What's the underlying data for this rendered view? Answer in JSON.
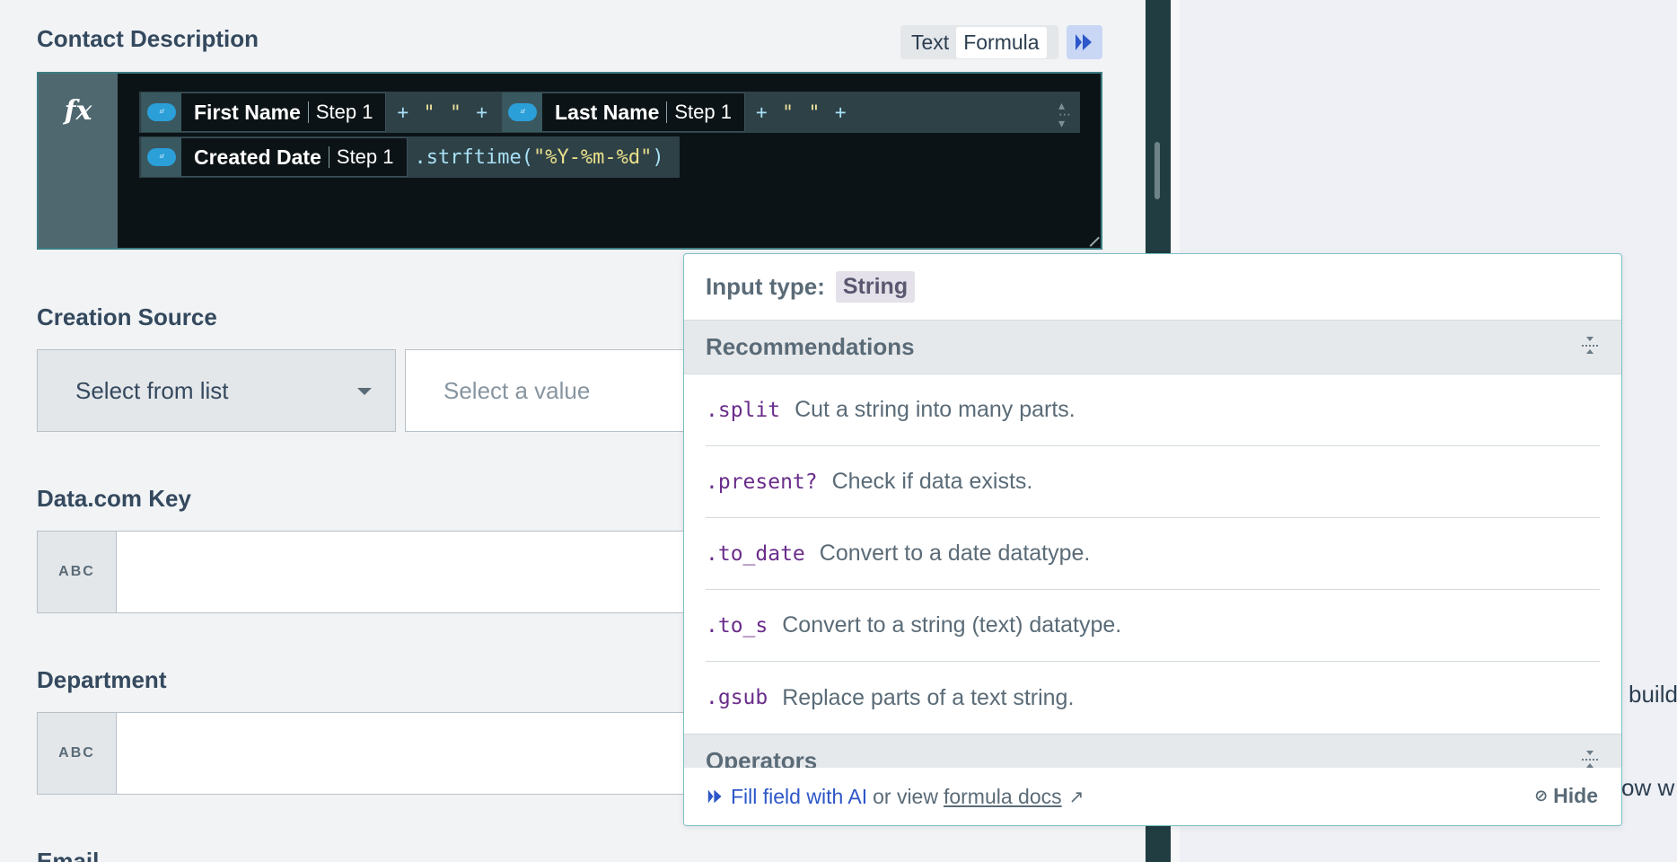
{
  "form": {
    "contact_description_label": "Contact Description",
    "toggle": {
      "text": "Text",
      "formula": "Formula",
      "active": "Formula"
    },
    "formula": {
      "fx": "fx",
      "pill1": {
        "name": "First Name",
        "step": "Step 1"
      },
      "op1": {
        "plus1": "+",
        "quotes": "\" \"",
        "plus2": "+"
      },
      "pill2": {
        "name": "Last Name",
        "step": "Step 1"
      },
      "op2": {
        "plus1": "+",
        "quotes": "\" \"",
        "plus2": "+"
      },
      "pill3": {
        "name": "Created Date",
        "step": "Step 1"
      },
      "code_method": ".strftime(",
      "code_string": "\"%Y-%m-%d\"",
      "code_close": ")"
    },
    "creation_source_label": "Creation Source",
    "select_from_list": "Select from list",
    "select_value_placeholder": "Select a value",
    "datacom_label": "Data.com Key",
    "abc": "ABC",
    "department_label": "Department",
    "email_label": "Email"
  },
  "popover": {
    "input_type_label": "Input type:",
    "input_type_value": "String",
    "recommendations_title": "Recommendations",
    "recommendations": [
      {
        "method": ".split",
        "desc": "Cut a string into many parts."
      },
      {
        "method": ".present?",
        "desc": "Check if data exists."
      },
      {
        "method": ".to_date",
        "desc": "Convert to a date datatype."
      },
      {
        "method": ".to_s",
        "desc": "Convert to a string (text) datatype."
      },
      {
        "method": ".gsub",
        "desc": "Replace parts of a text string."
      }
    ],
    "operators_title": "Operators",
    "footer": {
      "fill_ai": "Fill field with AI",
      "or_view": "or view",
      "formula_docs": "formula docs",
      "hide": "Hide"
    }
  },
  "right_panel": {
    "frag1": "build",
    "frag2": "ow w"
  },
  "icons": {
    "salesforce": "salesforce-logo-icon",
    "ai": "ai-sparkle-icon",
    "collapse": "collapse-icon",
    "external": "external-link-icon",
    "eye_off": "eye-off-icon"
  },
  "colors": {
    "accent": "#2d57c8",
    "editor_bg": "#0c1316",
    "method": "#6a2d8a"
  }
}
